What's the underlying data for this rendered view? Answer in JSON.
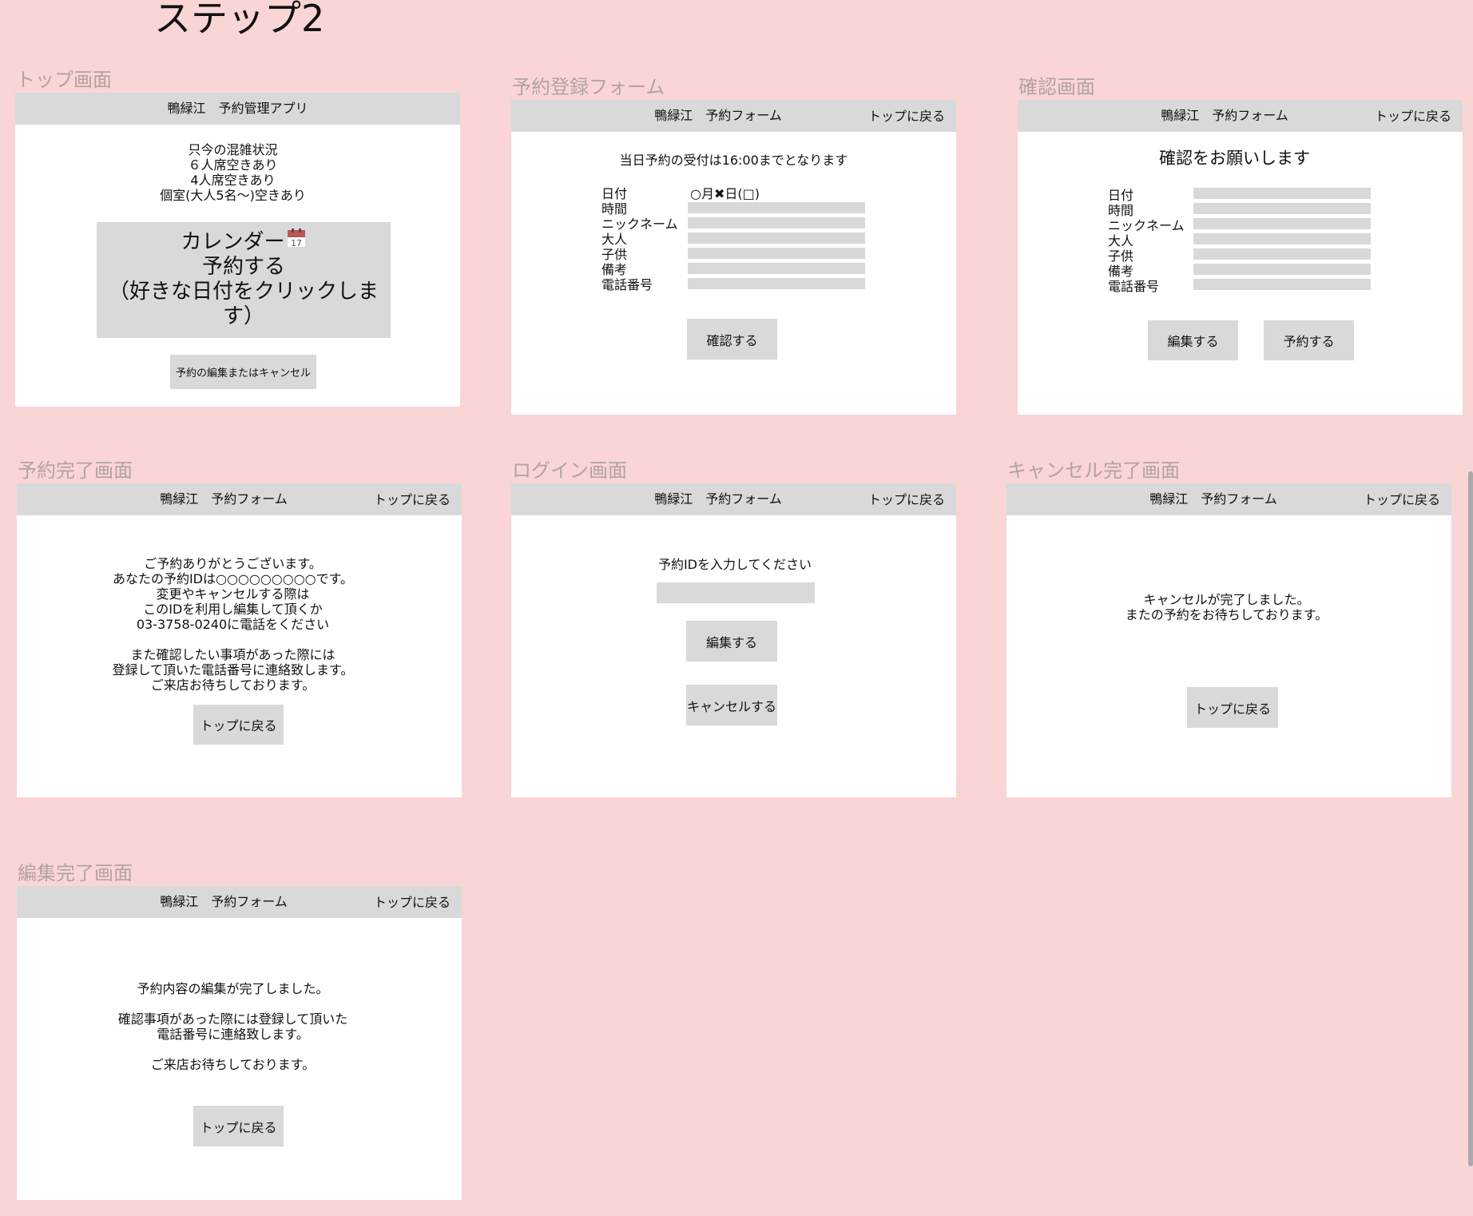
{
  "page_title": "ステップ2",
  "common": {
    "app_title_top": "鴨緑江　予約管理アプリ",
    "app_title_form": "鴨緑江　予約フォーム",
    "back_to_top": "トップに戻る"
  },
  "top_screen": {
    "label": "トップ画面",
    "status_lines": [
      "只今の混雑状況",
      "６人席空きあり",
      "4人席空きあり",
      "個室(大人5名〜)空きあり"
    ],
    "calendar_button_lines": [
      "カレンダー",
      "予約する",
      "（好きな日付をクリックしま",
      "す）"
    ],
    "calendar_icon": "calendar-icon",
    "calendar_icon_number": "17",
    "edit_cancel_button": "予約の編集またはキャンセル"
  },
  "registration_form": {
    "label": "予約登録フォーム",
    "notice": "当日予約の受付は16:00までとなります",
    "fields": [
      "日付",
      "時間",
      "ニックネーム",
      "大人",
      "子供",
      "備考",
      "電話番号"
    ],
    "date_value": "○月✖︎日(□)",
    "confirm_button": "確認する"
  },
  "confirm_screen": {
    "label": "確認画面",
    "heading": "確認をお願いします",
    "fields": [
      "日付",
      "時間",
      "ニックネーム",
      "大人",
      "子供",
      "備考",
      "電話番号"
    ],
    "edit_button": "編集する",
    "reserve_button": "予約する"
  },
  "complete_screen": {
    "label": "予約完了画面",
    "message_lines": [
      "ご予約ありがとうございます。",
      "あなたの予約IDは○○○○○○○○○です。",
      "変更やキャンセルする際は",
      "このIDを利用し編集して頂くか",
      "03-3758-0240に電話をください",
      "",
      "また確認したい事項があった際には",
      "登録して頂いた電話番号に連絡致します。",
      "ご来店お待ちしております。"
    ]
  },
  "login_screen": {
    "label": "ログイン画面",
    "prompt": "予約IDを入力してください",
    "edit_button": "編集する",
    "cancel_button": "キャンセルする"
  },
  "cancel_complete_screen": {
    "label": "キャンセル完了画面",
    "message_lines": [
      "キャンセルが完了しました。",
      "またの予約をお待ちしております。"
    ]
  },
  "edit_complete_screen": {
    "label": "編集完了画面",
    "message_lines": [
      "予約内容の編集が完了しました。",
      "",
      "確認事項があった際には登録して頂いた",
      "電話番号に連絡致します。",
      "",
      "ご来店お待ちしております。"
    ]
  },
  "colors": {
    "background": "#f9d5d6",
    "frame": "#ffffff",
    "gray_block": "#d9d9d9",
    "label_text": "#b3a2a3",
    "calendar_icon": "#b55a5a"
  }
}
